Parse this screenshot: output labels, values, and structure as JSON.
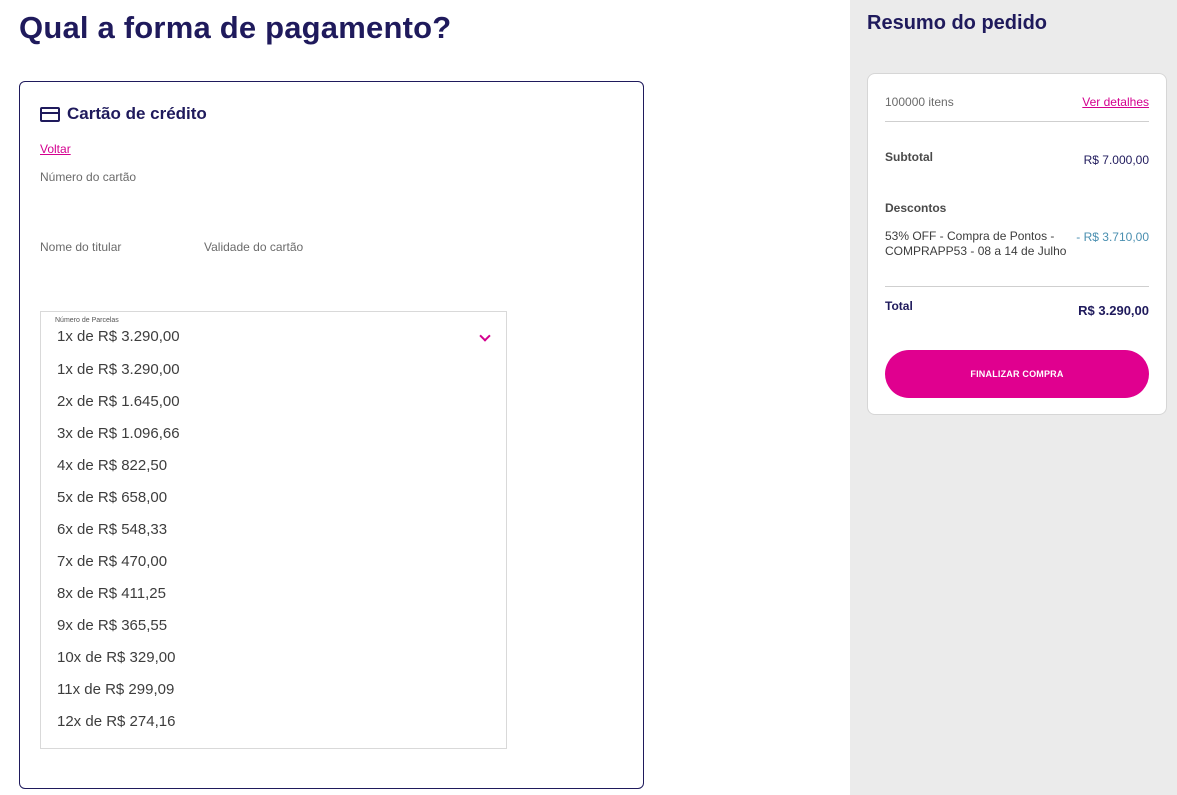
{
  "page": {
    "title": "Qual a forma de pagamento?"
  },
  "payment": {
    "method_title": "Cartão de crédito",
    "back_label": "Voltar",
    "card_number_label": "Número do cartão",
    "holder_label": "Nome do titular",
    "validity_label": "Validade do cartão",
    "installments": {
      "label": "Número de Parcelas",
      "selected": "1x de R$ 3.290,00",
      "options": [
        "1x de R$ 3.290,00",
        "2x de R$ 1.645,00",
        "3x de R$ 1.096,66",
        "4x de R$ 822,50",
        "5x de R$ 658,00",
        "6x de R$ 548,33",
        "7x de R$ 470,00",
        "8x de R$ 411,25",
        "9x de R$ 365,55",
        "10x de R$ 329,00",
        "11x de R$ 299,09",
        "12x de R$ 274,16"
      ]
    }
  },
  "summary": {
    "title": "Resumo do pedido",
    "items_count": "100000 itens",
    "details_link": "Ver detalhes",
    "subtotal_label": "Subtotal",
    "subtotal_value": "R$ 7.000,00",
    "discounts_label": "Descontos",
    "discount_description": "53% OFF - Compra de Pontos - COMPRAPP53 - 08 a 14 de Julho",
    "discount_value": "- R$ 3.710,00",
    "total_label": "Total",
    "total_value": "R$ 3.290,00",
    "finish_button": "FINALIZAR COMPRA"
  },
  "colors": {
    "brand_navy": "#1f1a5c",
    "accent_pink": "#e0008f",
    "discount_blue": "#4a8fb0",
    "sidebar_bg": "#ebebeb"
  }
}
